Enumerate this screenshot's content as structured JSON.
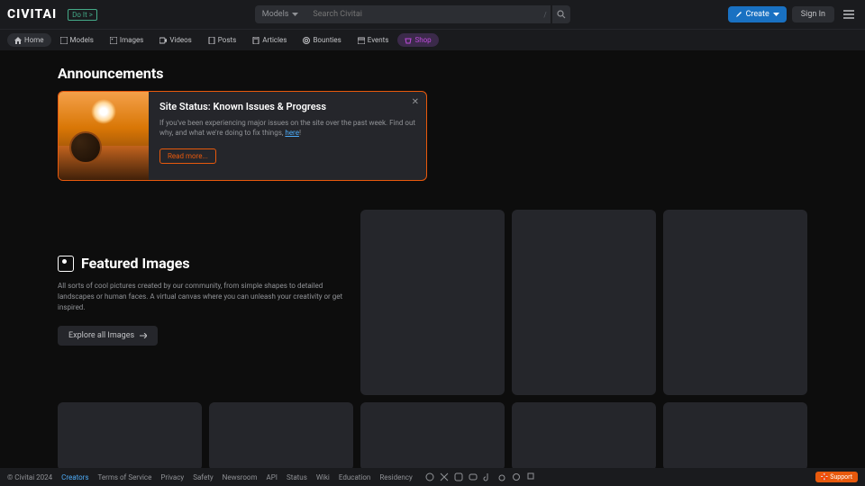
{
  "header": {
    "logo": "CIVITAI",
    "logo_badge": "Do It >",
    "search_selector": "Models",
    "search_placeholder": "Search Civitai",
    "search_kbd": "/",
    "create_label": "Create",
    "signin_label": "Sign In"
  },
  "nav": {
    "items": [
      {
        "label": "Home"
      },
      {
        "label": "Models"
      },
      {
        "label": "Images"
      },
      {
        "label": "Videos"
      },
      {
        "label": "Posts"
      },
      {
        "label": "Articles"
      },
      {
        "label": "Bounties"
      },
      {
        "label": "Events"
      },
      {
        "label": "Shop"
      }
    ]
  },
  "announcements": {
    "heading": "Announcements",
    "card": {
      "title": "Site Status: Known Issues & Progress",
      "text": "If you've been experiencing major issues on the site over the past week. Find out why, and what we're doing to fix things, ",
      "link_text": "here",
      "readmore": "Read more..."
    }
  },
  "featured": {
    "title": "Featured Images",
    "desc": "All sorts of cool pictures created by our community, from simple shapes to detailed landscapes or human faces. A virtual canvas where you can unleash your creativity or get inspired.",
    "explore": "Explore all Images"
  },
  "footer": {
    "copyright": "© Civitai 2024",
    "links": [
      "Creators",
      "Terms of Service",
      "Privacy",
      "Safety",
      "Newsroom",
      "API",
      "Status",
      "Wiki",
      "Education",
      "Residency"
    ],
    "support": "Support"
  }
}
